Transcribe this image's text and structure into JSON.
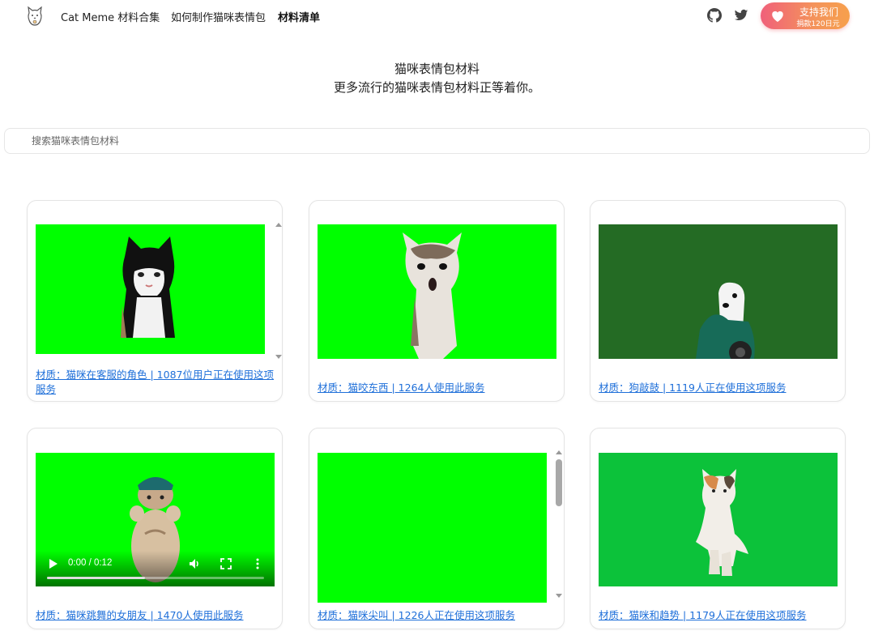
{
  "nav": {
    "brand_label": "Cat Meme 材料合集",
    "howto_label": "如何制作猫咪表情包",
    "list_label": "材料清单",
    "support_label": "支持我们",
    "support_sub": "捐款120日元"
  },
  "hero": {
    "line1": "猫咪表情包材料",
    "line2": "更多流行的猫咪表情包材料正等着你。"
  },
  "search": {
    "placeholder": "搜索猫咪表情包材料"
  },
  "cards": [
    {
      "caption": "材质：猫咪在客服的角色 | 1087位用户正在使用这项服务",
      "bg": "#00ff00"
    },
    {
      "caption": "材质：猫咬东西 | 1264人使用此服务",
      "bg": "#00ff00"
    },
    {
      "caption": "材质：狗敲鼓 | 1119人正在使用这项服务",
      "bg": "#246b24"
    },
    {
      "caption": "材质：猫咪跳舞的女朋友 | 1470人使用此服务",
      "bg": "#00ff00"
    },
    {
      "caption": "材质：猫咪尖叫 | 1226人正在使用这项服务",
      "bg": "#00ff00"
    },
    {
      "caption": "材质：猫咪和趋势 | 1179人正在使用这项服务",
      "bg": "#0cc23a"
    }
  ],
  "video": {
    "time": "0:00 / 0:12",
    "progress": 0.45
  },
  "colors": {
    "accent_link": "#1e6fd9",
    "support_gradient_start": "#f0607a",
    "support_gradient_end": "#f6a04c"
  },
  "icons": [
    "cat-logo-icon",
    "github-icon",
    "twitter-icon",
    "heart-icon",
    "play-icon",
    "volume-icon",
    "fullscreen-icon",
    "more-icon"
  ]
}
